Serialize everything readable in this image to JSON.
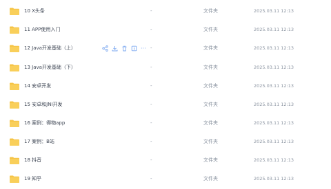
{
  "file_list": {
    "rows": [
      {
        "name": "10 X头条",
        "size": "-",
        "type": "文件夹",
        "date": "2025.03.11 12:13"
      },
      {
        "name": "11 APP使用入门",
        "size": "-",
        "type": "文件夹",
        "date": "2025.03.11 12:13"
      },
      {
        "name": "12 Java开发基础（上）",
        "size": "-",
        "type": "文件夹",
        "date": "2025.03.11 12:13"
      },
      {
        "name": "13 Java开发基础（下）",
        "size": "-",
        "type": "文件夹",
        "date": "2025.03.11 12:13"
      },
      {
        "name": "14 安卓开发",
        "size": "-",
        "type": "文件夹",
        "date": "2025.03.11 12:13"
      },
      {
        "name": "15 安卓和JNI开发",
        "size": "-",
        "type": "文件夹",
        "date": "2025.03.11 12:13"
      },
      {
        "name": "16 案例：得物app",
        "size": "-",
        "type": "文件夹",
        "date": "2025.03.11 12:13"
      },
      {
        "name": "17 案例：B站",
        "size": "-",
        "type": "文件夹",
        "date": "2025.03.11 12:13"
      },
      {
        "name": "18 抖音",
        "size": "-",
        "type": "文件夹",
        "date": "2025.03.11 12:13"
      },
      {
        "name": "19 知乎",
        "size": "-",
        "type": "文件夹",
        "date": "2025.03.11 12:13"
      }
    ],
    "hover_actions": [
      "share-icon",
      "download-icon",
      "delete-icon",
      "info-icon",
      "more-icon"
    ],
    "more_label": "···"
  },
  "colors": {
    "folder": "#f6c446",
    "folder_tab": "#f0b429",
    "action_icon": "#7aa7f0"
  }
}
